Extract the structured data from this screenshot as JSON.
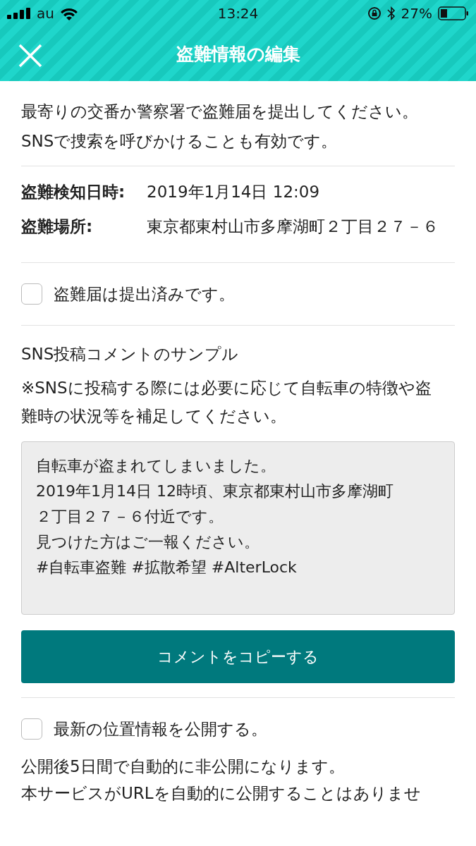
{
  "status_bar": {
    "carrier": "au",
    "time": "13:24",
    "battery": "27%"
  },
  "header": {
    "title": "盗難情報の編集"
  },
  "intro": [
    "最寄りの交番か警察署で盗難届を提出してください。",
    "SNSで捜索を呼びかけることも有効です。"
  ],
  "details": [
    {
      "label": "盗難検知日時:",
      "value": "2019年1月14日 12:09"
    },
    {
      "label": "盗難場所:",
      "value": "東京都東村山市多摩湖町２丁目２７－６"
    }
  ],
  "report_checkbox": {
    "label": "盗難届は提出済みです。",
    "checked": false
  },
  "sns": {
    "heading": "SNS投稿コメントのサンプル",
    "note": "※SNSに投稿する際には必要に応じて自転車の特徴や盗難時の状況等を補足してください。",
    "comment": [
      "自転車が盗まれてしまいました。",
      "2019年1月14日 12時頃、東京都東村山市多摩湖町",
      "２丁目２７－６付近です。",
      "見つけた方はご一報ください。",
      "#自転車盗難 #拡散希望 #AlterLock"
    ],
    "copy_button": "コメントをコピーする"
  },
  "location_checkbox": {
    "label": "最新の位置情報を公開する。",
    "checked": false
  },
  "footer_text": [
    "公開後5日間で自動的に非公開になります。",
    "本サービスがURLを自動的に公開することはありませ"
  ]
}
